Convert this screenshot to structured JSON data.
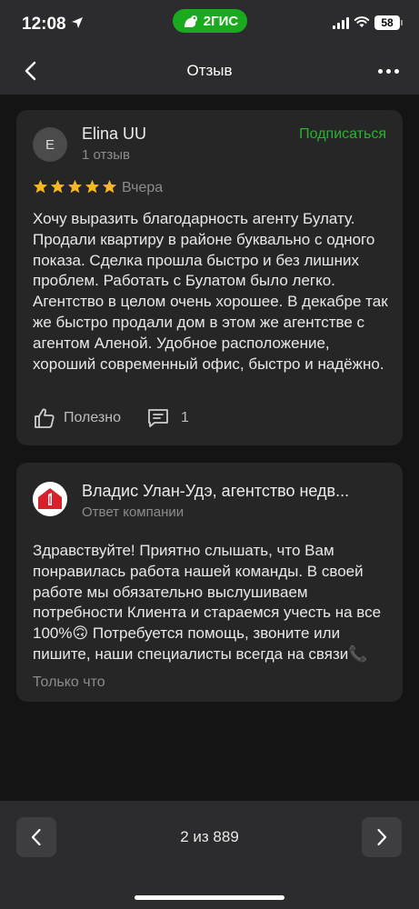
{
  "status_bar": {
    "time": "12:08",
    "brand": "2ГИС",
    "battery": "58",
    "icons": [
      "location-arrow-icon",
      "signal-icon",
      "wifi-icon",
      "battery-icon"
    ]
  },
  "nav": {
    "title": "Отзыв",
    "back_icon": "chevron-left-icon",
    "more_icon": "more-dots-icon"
  },
  "review": {
    "author_initial": "E",
    "author": "Elina UU",
    "author_reviews": "1 отзыв",
    "subscribe_label": "Подписаться",
    "rating": 5,
    "date": "Вчера",
    "text": "Хочу выразить благодарность агенту Булату. Продали квартиру в районе буквально с одного показа. Сделка прошла быстро и без лишних проблем. Работать с Булатом было легко. Агентство в целом очень хорошее. В декабре так же быстро продали дом в этом же агентстве с агентом Аленой. Удобное расположение, хороший современный офис, быстро и надёжно.",
    "useful_label": "Полезно",
    "comments_count": "1"
  },
  "reply": {
    "company": "Владис Улан-Удэ, агентство недв...",
    "role": "Ответ компании",
    "text": "Здравствуйте! Приятно слышать, что Вам понравилась работа нашей команды. В своей работе мы обязательно выслушиваем потребности Клиента и стараемся учесть на все 100%🙃 Потребуется помощь, звоните или пишите, наши специалисты всегда на связи📞",
    "time": "Только что"
  },
  "pager": {
    "label": "2 из 889"
  },
  "colors": {
    "accent_green": "#29b330",
    "brand_green": "#19aa1e",
    "star": "#f5b820",
    "background": "#141414",
    "card": "#262626",
    "bar": "#2c2c2e"
  }
}
